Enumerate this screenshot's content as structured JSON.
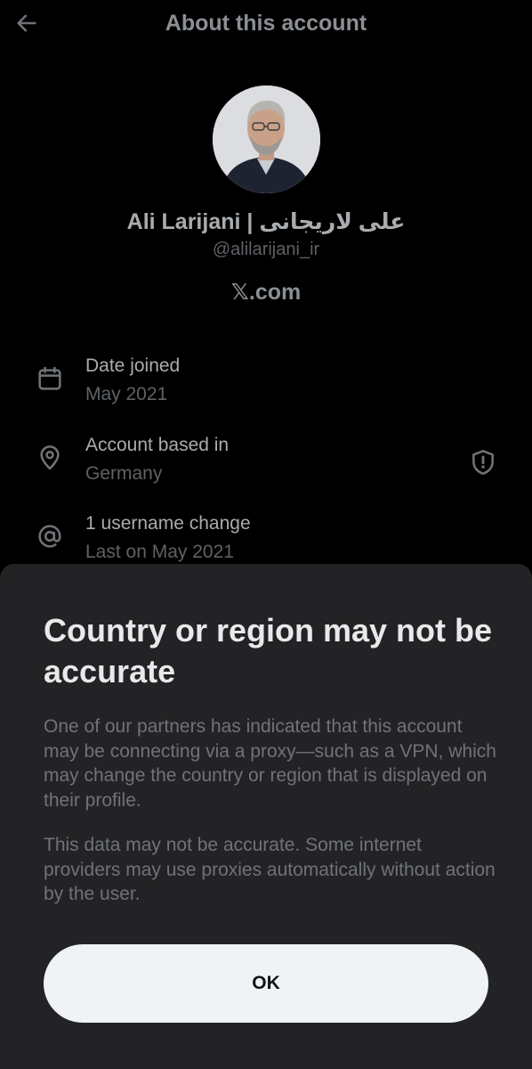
{
  "header": {
    "title": "About this account",
    "back_icon": "arrow-left-icon"
  },
  "profile": {
    "display_name": "Ali Larijani | علی لاریجانی",
    "handle": "@alilarijani_ir",
    "site": "𝕏.com",
    "avatar": "avatar-photo"
  },
  "info": {
    "date_joined": {
      "icon": "calendar-icon",
      "title": "Date joined",
      "value": "May 2021"
    },
    "account_based": {
      "icon": "location-pin-icon",
      "title": "Account based in",
      "value": "Germany",
      "action_icon": "shield-alert-icon"
    },
    "username_changes": {
      "icon": "at-sign-icon",
      "title": "1 username change",
      "value": "Last on May 2021"
    }
  },
  "sheet": {
    "title": "Country or region may not be accurate",
    "paragraph1": "One of our partners has indicated that this account may be connecting via a proxy—such as a VPN, which may change the country or region that is displayed on their profile.",
    "paragraph2": "This data may not be accurate. Some internet providers may use proxies automatically without action by the user.",
    "ok_label": "OK"
  },
  "colors": {
    "background": "#000000",
    "sheet_background": "#232325",
    "button_background": "#eff3f4",
    "muted_text": "#5e6266",
    "primary_text": "#e7e9ea"
  }
}
